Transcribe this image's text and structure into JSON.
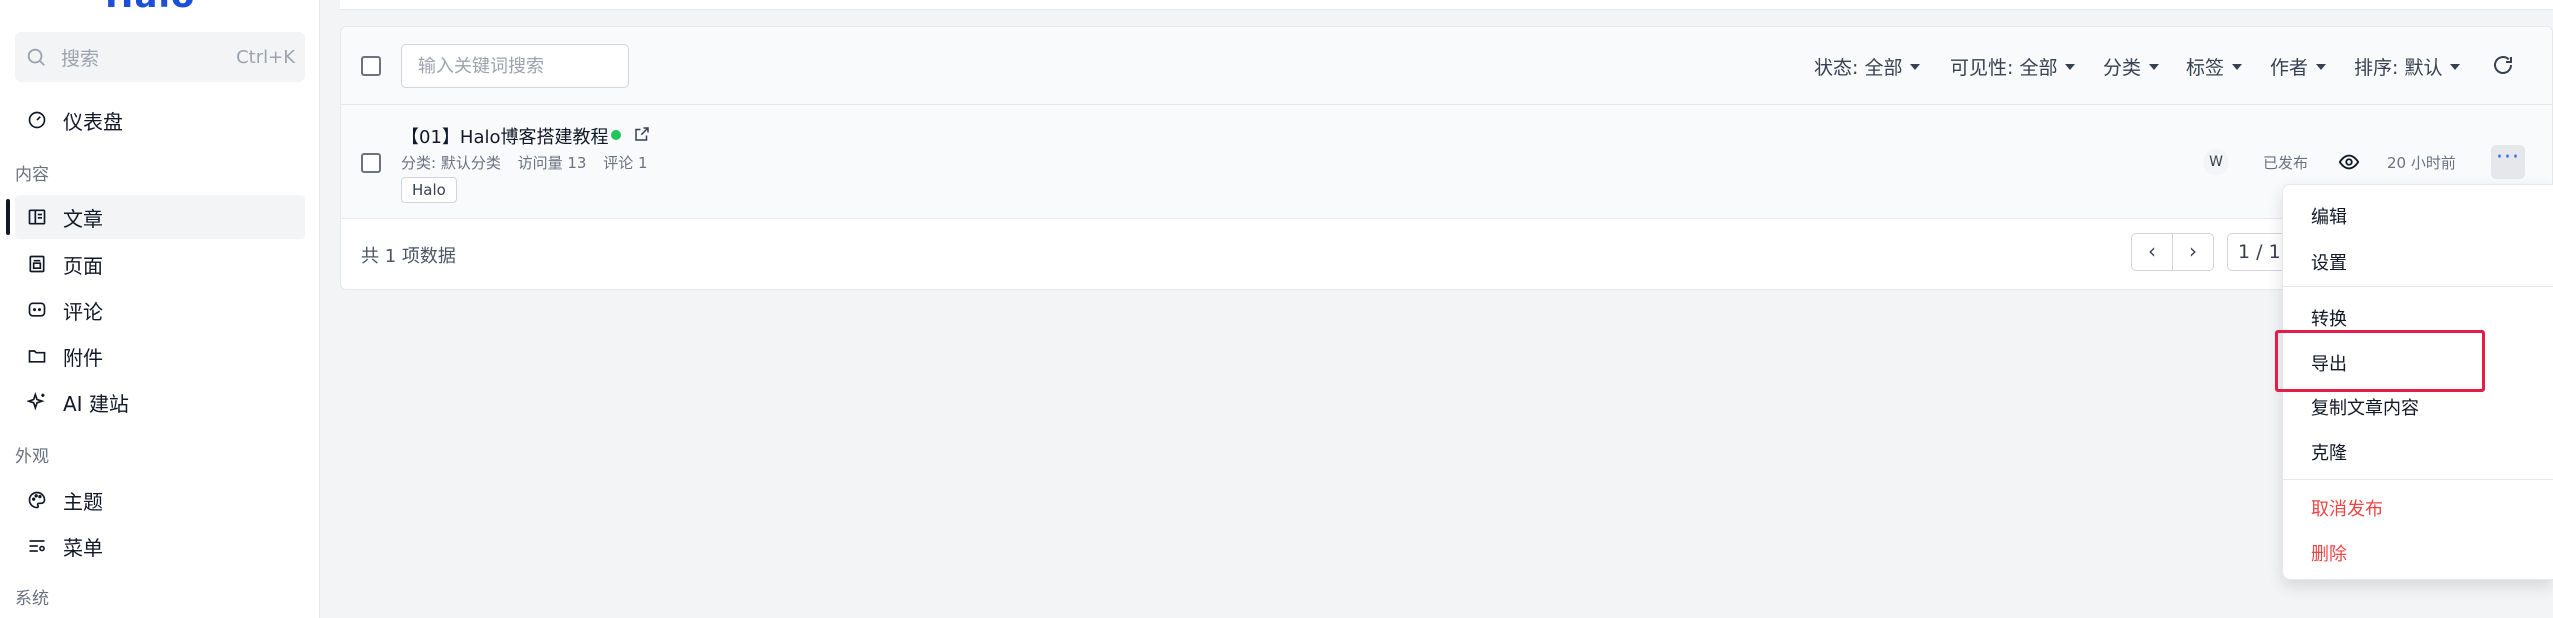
{
  "app": {
    "logo": "Halo"
  },
  "search": {
    "placeholder": "搜索",
    "shortcut": "Ctrl+K"
  },
  "sidebar": {
    "dashboard": "仪表盘",
    "groups": [
      "内容",
      "外观",
      "系统"
    ],
    "content_items": [
      {
        "label": "文章",
        "icon": "article-icon",
        "active": true
      },
      {
        "label": "页面",
        "icon": "page-icon",
        "active": false
      },
      {
        "label": "评论",
        "icon": "comment-icon",
        "active": false
      },
      {
        "label": "附件",
        "icon": "folder-icon",
        "active": false
      },
      {
        "label": "AI 建站",
        "icon": "sparkle-icon",
        "active": false
      }
    ],
    "appearance_items": [
      {
        "label": "主题",
        "icon": "palette-icon"
      },
      {
        "label": "菜单",
        "icon": "menu-icon"
      }
    ]
  },
  "toolbar": {
    "keyword_placeholder": "输入关键词搜索",
    "filters": [
      "状态: 全部",
      "可见性: 全部",
      "分类",
      "标签",
      "作者",
      "排序: 默认"
    ]
  },
  "post": {
    "title": "【01】Halo博客搭建教程",
    "category": "分类: 默认分类",
    "views": "访问量 13",
    "comments": "评论 1",
    "tag": "Halo",
    "author_initial": "W",
    "status": "已发布",
    "time": "20 小时前"
  },
  "footer": {
    "count": "共 1 项数据",
    "page_indicator": "1 / 1"
  },
  "menu": {
    "items": [
      "编辑",
      "设置",
      "转换",
      "导出",
      "复制文章内容",
      "克隆"
    ],
    "danger_items": [
      "取消发布",
      "删除"
    ]
  },
  "colors": {
    "accent": "#2563eb",
    "published": "#22c55e",
    "danger": "#ef4444",
    "highlight": "#e11d48"
  }
}
